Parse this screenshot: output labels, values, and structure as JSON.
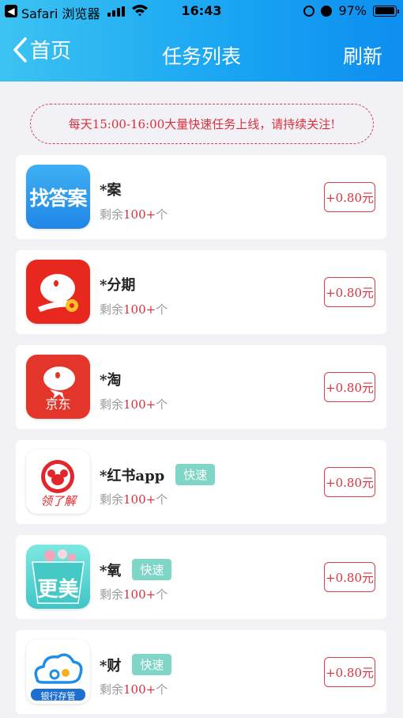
{
  "status_bar": {
    "carrier": "Safari 浏览器",
    "time": "16:43",
    "battery": "97%",
    "battery_level": 0.97
  },
  "nav": {
    "back_label": "首页",
    "title": "任务列表",
    "refresh_label": "刷新"
  },
  "notice": "每天15:00-16:00大量快速任务上线，请持续关注!",
  "tasks": [
    {
      "name": "*案",
      "badge": "",
      "remain_prefix": "剩余",
      "remain_num": "100+",
      "remain_suffix": "个",
      "price": "+0.80元",
      "logo": "zhaodaan-icon"
    },
    {
      "name": "*分期",
      "badge": "",
      "remain_prefix": "剩余",
      "remain_num": "100+",
      "remain_suffix": "个",
      "price": "+0.80元",
      "logo": "jd-finance-icon"
    },
    {
      "name": "*淘",
      "badge": "",
      "remain_prefix": "剩余",
      "remain_num": "100+",
      "remain_suffix": "个",
      "price": "+0.80元",
      "logo": "jd-icon"
    },
    {
      "name": "*红书app",
      "badge": "快速",
      "remain_prefix": "剩余",
      "remain_num": "100+",
      "remain_suffix": "个",
      "price": "+0.80元",
      "logo": "koala-icon"
    },
    {
      "name": "*氧",
      "badge": "快速",
      "remain_prefix": "剩余",
      "remain_num": "100+",
      "remain_suffix": "个",
      "price": "+0.80元",
      "logo": "gengmei-icon"
    },
    {
      "name": "*财",
      "badge": "快速",
      "remain_prefix": "剩余",
      "remain_num": "100+",
      "remain_suffix": "个",
      "price": "+0.80元",
      "logo": "bank-cloud-icon"
    }
  ],
  "logos": {
    "zhaodaan_text": "找答案",
    "jd_text": "京东",
    "koala_text": "领了解",
    "gengmei_text": "更美",
    "bank_text": "银行存管"
  },
  "colors": {
    "accent_red": "#d8303d",
    "header_start": "#3cc3f2",
    "header_end": "#0e8ef0",
    "badge": "#7fd6c6"
  }
}
